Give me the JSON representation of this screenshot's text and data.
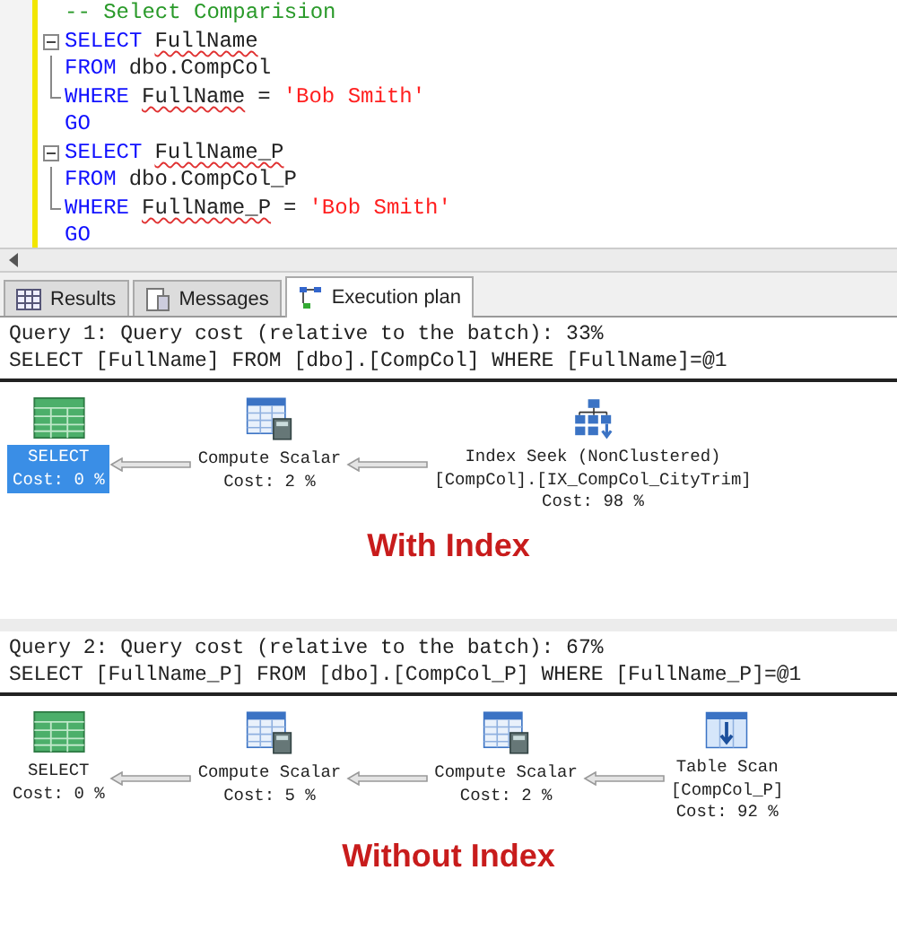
{
  "editor": {
    "items": [
      {
        "kind": "line",
        "tokens": [
          {
            "kind": "comment",
            "text": "-- Select Comparision",
            "squiggle": false
          }
        ]
      },
      {
        "kind": "statement",
        "children": [
          {
            "tokens": [
              {
                "kind": "keyword",
                "text": "SELECT",
                "squiggle": false
              },
              {
                "kind": "ident",
                "text": "FullName",
                "squiggle": true
              }
            ]
          },
          {
            "tokens": [
              {
                "kind": "keyword",
                "text": "FROM",
                "squiggle": false
              },
              {
                "kind": "ident",
                "text": "dbo.CompCol",
                "squiggle": false
              }
            ]
          },
          {
            "tokens": [
              {
                "kind": "keyword",
                "text": "WHERE",
                "squiggle": false
              },
              {
                "kind": "ident",
                "text": "FullName",
                "squiggle": true
              },
              {
                "kind": "ident",
                "text": "=",
                "squiggle": false
              },
              {
                "kind": "string",
                "text": "'Bob Smith'",
                "squiggle": false
              }
            ]
          }
        ]
      },
      {
        "kind": "line",
        "tokens": [
          {
            "kind": "keyword",
            "text": "GO",
            "squiggle": false
          }
        ]
      },
      {
        "kind": "statement",
        "children": [
          {
            "tokens": [
              {
                "kind": "keyword",
                "text": "SELECT",
                "squiggle": false
              },
              {
                "kind": "ident",
                "text": "FullName_P",
                "squiggle": true
              }
            ]
          },
          {
            "tokens": [
              {
                "kind": "keyword",
                "text": "FROM",
                "squiggle": false
              },
              {
                "kind": "ident",
                "text": "dbo.CompCol_P",
                "squiggle": false
              }
            ]
          },
          {
            "tokens": [
              {
                "kind": "keyword",
                "text": "WHERE",
                "squiggle": false
              },
              {
                "kind": "ident",
                "text": "FullName_P",
                "squiggle": true
              },
              {
                "kind": "ident",
                "text": "=",
                "squiggle": false
              },
              {
                "kind": "string",
                "text": "'Bob Smith'",
                "squiggle": false
              }
            ]
          }
        ]
      },
      {
        "kind": "line",
        "tokens": [
          {
            "kind": "keyword",
            "text": "GO",
            "squiggle": false
          }
        ]
      }
    ]
  },
  "tabs": [
    {
      "label": "Results",
      "selected": false
    },
    {
      "label": "Messages",
      "selected": false
    },
    {
      "label": "Execution plan",
      "selected": true
    }
  ],
  "queries": [
    {
      "header": "Query 1: Query cost (relative to the batch): 33%",
      "sql": "SELECT [FullName] FROM [dbo].[CompCol] WHERE [FullName]=@1",
      "caption": "With Index",
      "nodes": [
        {
          "kind": "select",
          "selected": true,
          "lines": [
            "SELECT",
            "Cost: 0 %"
          ]
        },
        {
          "kind": "compute",
          "selected": false,
          "lines": [
            "Compute Scalar",
            "Cost: 2 %"
          ]
        },
        {
          "kind": "seek",
          "selected": false,
          "lines": [
            "Index Seek (NonClustered)",
            "[CompCol].[IX_CompCol_CityTrim]",
            "Cost: 98 %"
          ]
        }
      ]
    },
    {
      "header": "Query 2: Query cost (relative to the batch): 67%",
      "sql": "SELECT [FullName_P] FROM [dbo].[CompCol_P] WHERE [FullName_P]=@1",
      "caption": "Without Index",
      "nodes": [
        {
          "kind": "select",
          "selected": false,
          "lines": [
            "SELECT",
            "Cost: 0 %"
          ]
        },
        {
          "kind": "compute",
          "selected": false,
          "lines": [
            "Compute Scalar",
            "Cost: 5 %"
          ]
        },
        {
          "kind": "compute",
          "selected": false,
          "lines": [
            "Compute Scalar",
            "Cost: 2 %"
          ]
        },
        {
          "kind": "scan",
          "selected": false,
          "lines": [
            "Table Scan",
            "[CompCol_P]",
            "Cost: 92 %"
          ]
        }
      ]
    }
  ]
}
